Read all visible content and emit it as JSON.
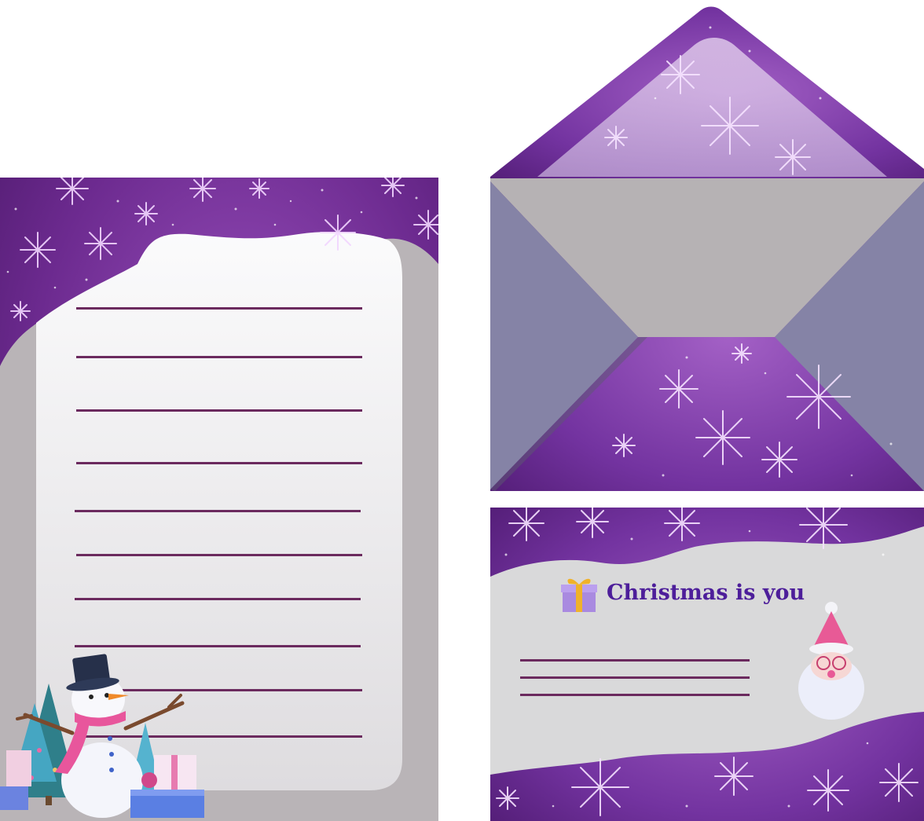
{
  "letter": {
    "line_count": 10
  },
  "envelope_card": {
    "title": "Christmas is you",
    "gift_icon": "gift-box-icon",
    "santa_icon": "santa-head-icon",
    "line_count": 3
  },
  "decorations": {
    "snowman": "snowman-icon",
    "trees": "christmas-tree-icon",
    "gifts": "gift-stack-icon",
    "snowflakes": "snowflake-icon"
  },
  "colors": {
    "purple_dark": "#5a1f7e",
    "purple_mid": "#8a3fb0",
    "line_color": "#6b2a5e",
    "paper_light": "#f6f6f7",
    "paper_shadow": "#b9b4b7",
    "envelope_grey": "#b6b2b4",
    "envelope_side": "#8583a6",
    "title_color": "#4d1e9a"
  }
}
